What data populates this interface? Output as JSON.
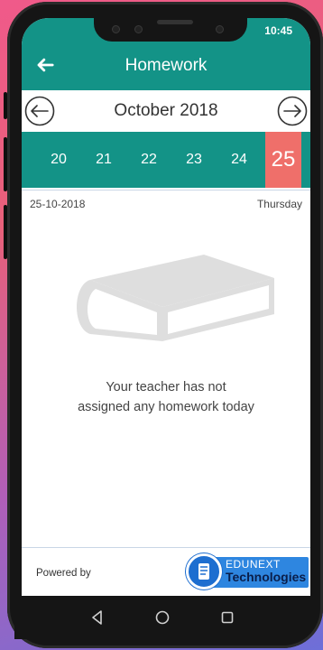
{
  "status_bar": {
    "time": "10:45"
  },
  "app_bar": {
    "title": "Homework",
    "back_icon": "arrow-left-icon"
  },
  "month_nav": {
    "label": "October 2018",
    "prev_icon": "circle-arrow-left-icon",
    "next_icon": "circle-arrow-right-icon"
  },
  "days": [
    {
      "label": "20",
      "selected": false
    },
    {
      "label": "21",
      "selected": false
    },
    {
      "label": "22",
      "selected": false
    },
    {
      "label": "23",
      "selected": false
    },
    {
      "label": "24",
      "selected": false
    },
    {
      "label": "25",
      "selected": true
    }
  ],
  "selected_date": {
    "date": "25-10-2018",
    "weekday": "Thursday"
  },
  "empty_state": {
    "icon": "book-icon",
    "line1": "Your teacher has not",
    "line2": "assigned any homework today"
  },
  "footer": {
    "powered_by": "Powered by",
    "logo_top": "EDUNEXT",
    "logo_bottom": "Technologies"
  },
  "colors": {
    "primary": "#139387",
    "selected_day": "#ef6f6a",
    "logo_blue": "#2e86e0"
  },
  "system_nav": {
    "back": "back-triangle-icon",
    "home": "home-circle-icon",
    "recents": "recents-square-icon"
  }
}
